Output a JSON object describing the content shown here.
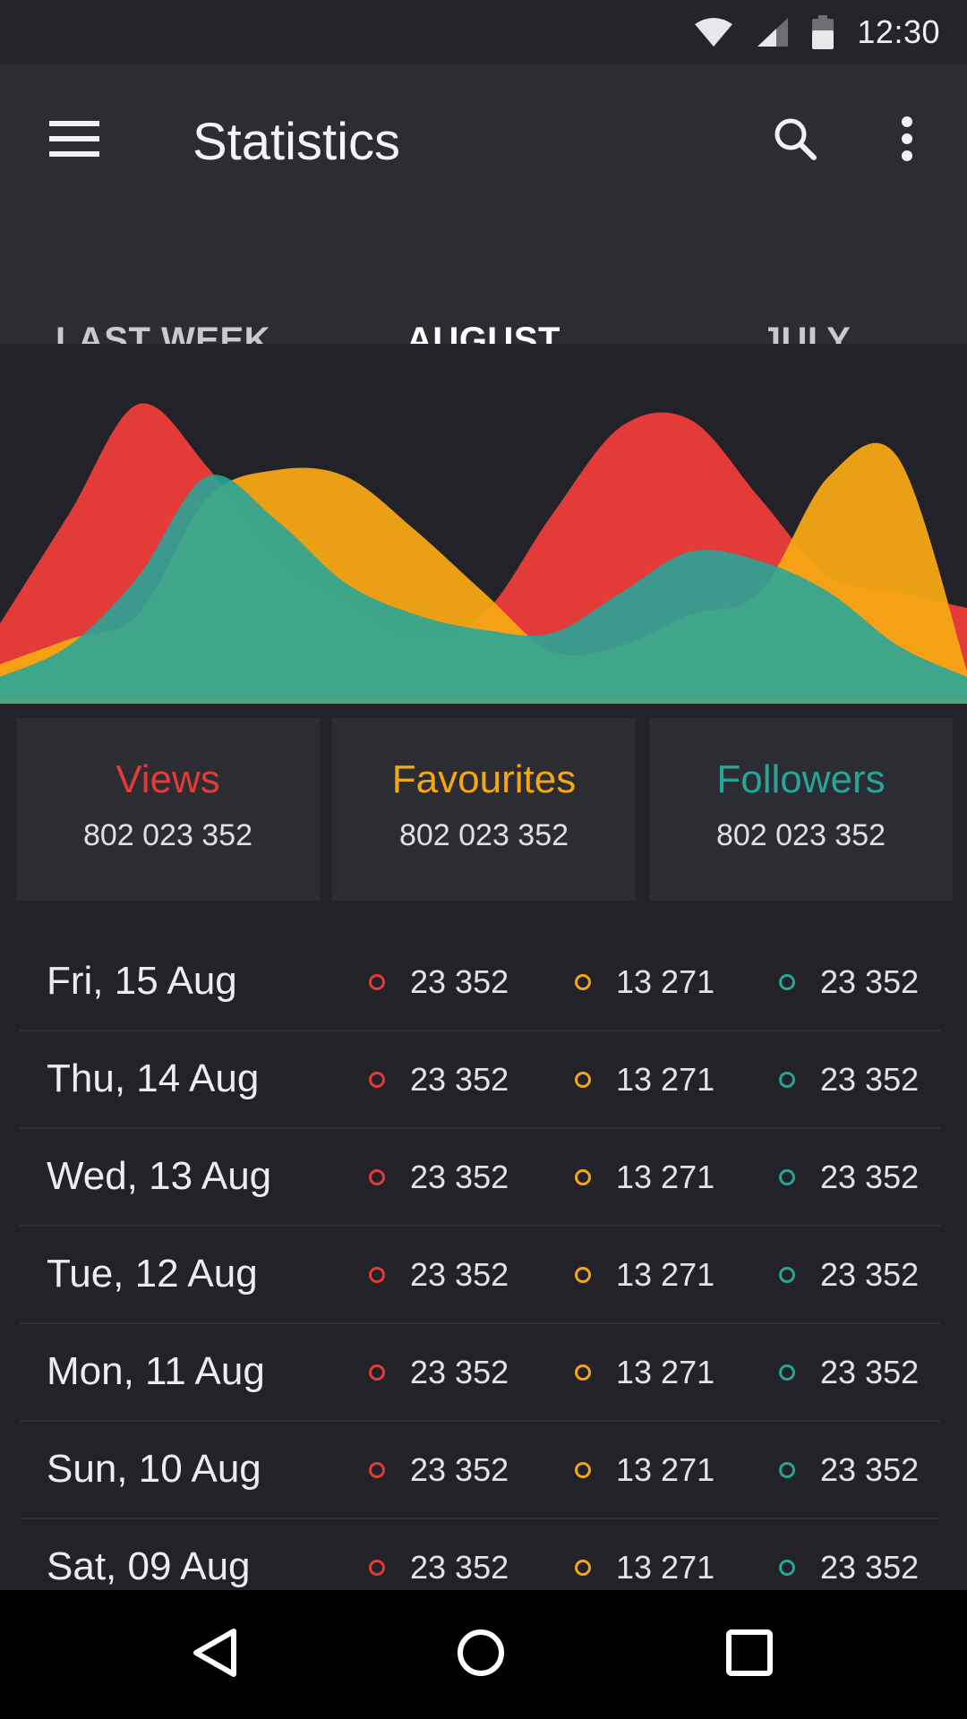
{
  "status_bar": {
    "time": "12:30",
    "icons": [
      "wifi-icon",
      "signal-icon",
      "battery-icon"
    ]
  },
  "app_bar": {
    "title": "Statistics",
    "icons": [
      "menu-icon",
      "search-icon",
      "more-vert-icon"
    ]
  },
  "tabs": [
    {
      "label": "LAST WEEK",
      "active": false
    },
    {
      "label": "AUGUST",
      "active": true
    },
    {
      "label": "JULY",
      "active": false
    }
  ],
  "colors": {
    "views": "#e33b37",
    "favourites": "#f5a613",
    "followers": "#26a69a",
    "tab_indicator": "#e33b37",
    "background": "#222228",
    "surface": "#2c2c33"
  },
  "chart_data": {
    "type": "area",
    "title": "",
    "xlabel": "",
    "ylabel": "",
    "ylim": [
      0,
      100
    ],
    "x": [
      0,
      1,
      2,
      3,
      4,
      5,
      6,
      7,
      8,
      9,
      10,
      11,
      12,
      13,
      14
    ],
    "series": [
      {
        "name": "Views",
        "values": [
          25,
          60,
          95,
          75,
          45,
          32,
          20,
          28,
          60,
          88,
          90,
          65,
          40,
          35,
          30
        ]
      },
      {
        "name": "Favourites",
        "values": [
          12,
          20,
          28,
          65,
          74,
          72,
          55,
          35,
          16,
          18,
          28,
          35,
          72,
          78,
          10
        ]
      },
      {
        "name": "Followers",
        "values": [
          8,
          18,
          40,
          72,
          58,
          38,
          28,
          23,
          22,
          35,
          48,
          45,
          35,
          18,
          8
        ]
      }
    ]
  },
  "summary": {
    "views": {
      "label": "Views",
      "value": "802 023 352"
    },
    "favourites": {
      "label": "Favourites",
      "value": "802 023 352"
    },
    "followers": {
      "label": "Followers",
      "value": "802 023 352"
    }
  },
  "rows": [
    {
      "date": "Fri, 15 Aug",
      "views": "23 352",
      "favourites": "13 271",
      "followers": "23 352"
    },
    {
      "date": "Thu, 14 Aug",
      "views": "23 352",
      "favourites": "13 271",
      "followers": "23 352"
    },
    {
      "date": "Wed, 13 Aug",
      "views": "23 352",
      "favourites": "13 271",
      "followers": "23 352"
    },
    {
      "date": "Tue, 12 Aug",
      "views": "23 352",
      "favourites": "13 271",
      "followers": "23 352"
    },
    {
      "date": "Mon, 11 Aug",
      "views": "23 352",
      "favourites": "13 271",
      "followers": "23 352"
    },
    {
      "date": "Sun, 10 Aug",
      "views": "23 352",
      "favourites": "13 271",
      "followers": "23 352"
    },
    {
      "date": "Sat, 09 Aug",
      "views": "23 352",
      "favourites": "13 271",
      "followers": "23 352"
    }
  ],
  "nav_bar": {
    "icons": [
      "back-icon",
      "home-icon",
      "recents-icon"
    ]
  }
}
